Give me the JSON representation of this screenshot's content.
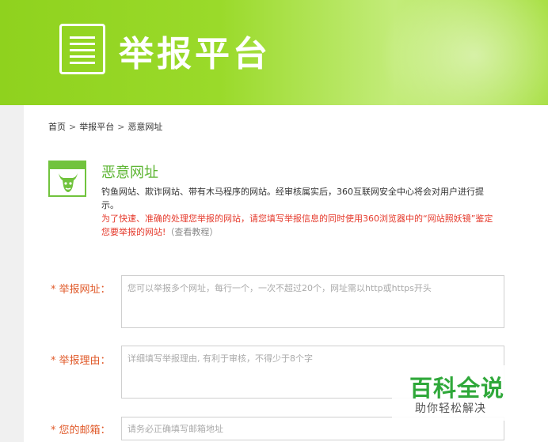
{
  "header": {
    "title": "举报平台",
    "icon": "report-document-icon",
    "colors": {
      "green": "#8fd21e",
      "light_green": "#c3ec7a"
    }
  },
  "breadcrumb": {
    "items": [
      "首页",
      "举报平台",
      "恶意网址"
    ],
    "separator": ">"
  },
  "category": {
    "icon": "malicious-bull-icon",
    "title": "恶意网址",
    "description": "钓鱼网站、欺诈网站、带有木马程序的网站。经审核属实后，360互联网安全中心将会对用户进行提示。",
    "warning": "为了快速、准确的处理您举报的网站，请您填写举报信息的同时使用360浏览器中的“网站照妖镜”鉴定您要举报的网站!",
    "tutorial_link": "（查看教程）",
    "accent_color": "#5db533",
    "warning_color": "#e53a2c"
  },
  "form": {
    "required_mark": "*",
    "url": {
      "label": "举报网址：",
      "value": "",
      "placeholder": "您可以举报多个网址，每行一个，一次不超过20个，网址需以http或https开头"
    },
    "reason": {
      "label": "举报理由：",
      "value": "",
      "placeholder": "详细填写举报理由, 有利于审核，不得少于8个字"
    },
    "email": {
      "label": "您的邮箱：",
      "value": "",
      "placeholder": "请务必正确填写邮箱地址"
    }
  },
  "watermark": {
    "title": "百科全说",
    "subtitle": "助你轻松解决"
  }
}
